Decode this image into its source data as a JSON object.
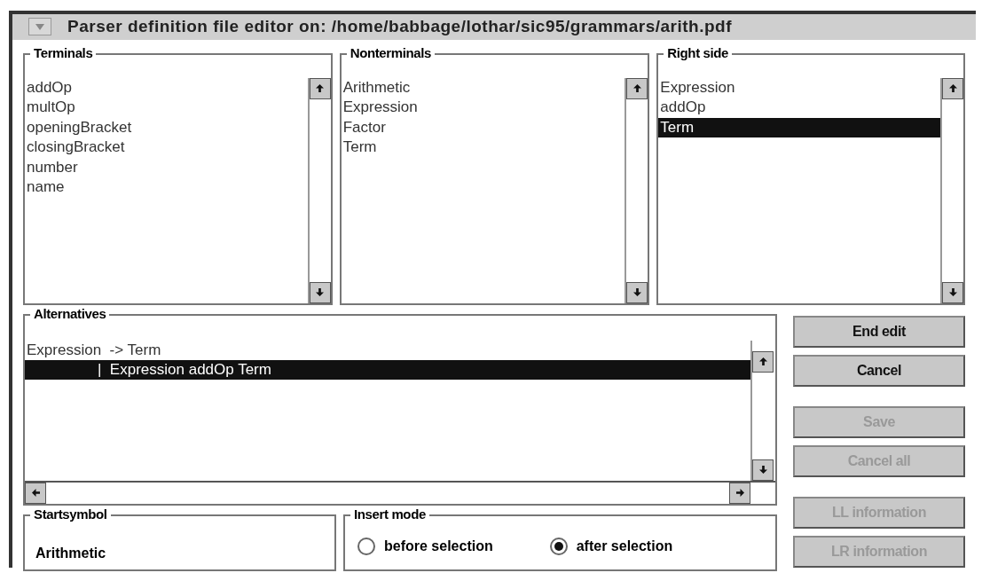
{
  "window": {
    "title": "Parser definition file editor on: /home/babbage/lothar/sic95/grammars/arith.pdf"
  },
  "terminals": {
    "label": "Terminals",
    "items": [
      {
        "text": "addOp",
        "selected": false
      },
      {
        "text": "multOp",
        "selected": false
      },
      {
        "text": "openingBracket",
        "selected": false
      },
      {
        "text": "closingBracket",
        "selected": false
      },
      {
        "text": "number",
        "selected": false
      },
      {
        "text": "name",
        "selected": false
      }
    ]
  },
  "nonterminals": {
    "label": "Nonterminals",
    "items": [
      {
        "text": "Arithmetic",
        "selected": false
      },
      {
        "text": "Expression",
        "selected": false
      },
      {
        "text": "Factor",
        "selected": false
      },
      {
        "text": "Term",
        "selected": false
      }
    ]
  },
  "right_side": {
    "label": "Right side",
    "items": [
      {
        "text": "Expression",
        "selected": false
      },
      {
        "text": "addOp",
        "selected": false
      },
      {
        "text": "Term",
        "selected": true
      }
    ]
  },
  "alternatives": {
    "label": "Alternatives",
    "items": [
      {
        "kind": "rule",
        "text": "Expression  -> Term",
        "selected": false
      },
      {
        "kind": "alternative",
        "text": "|  Expression addOp Term",
        "selected": true
      }
    ]
  },
  "startsymbol": {
    "label": "Startsymbol",
    "value": "Arithmetic"
  },
  "insert_mode": {
    "label": "Insert mode",
    "options": [
      {
        "label": "before selection",
        "selected": false
      },
      {
        "label": "after selection",
        "selected": true
      }
    ]
  },
  "buttons": [
    {
      "label": "End edit",
      "disabled": false
    },
    {
      "label": "Cancel",
      "disabled": false
    },
    {
      "label": "Save",
      "disabled": true
    },
    {
      "label": "Cancel all",
      "disabled": true
    },
    {
      "label": "LL information",
      "disabled": true
    },
    {
      "label": "LR information",
      "disabled": true
    }
  ]
}
